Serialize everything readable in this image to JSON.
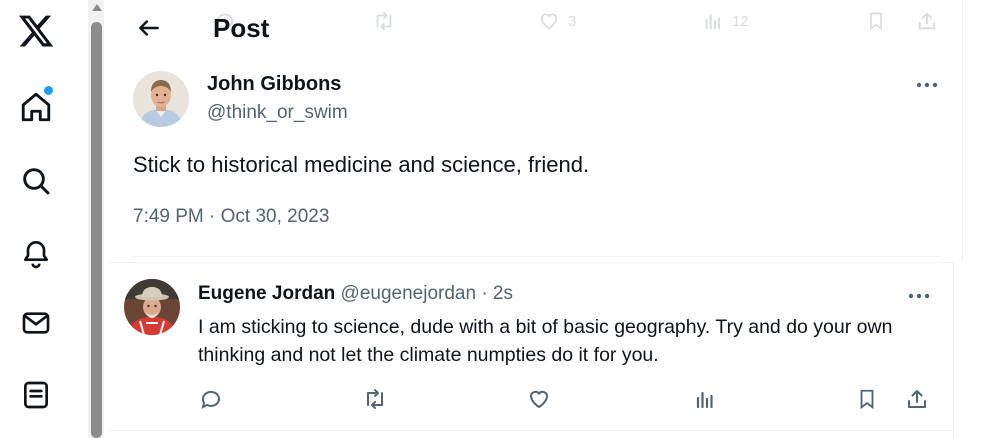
{
  "nav": {
    "items": [
      {
        "icon": "x-logo-icon"
      },
      {
        "icon": "home-icon",
        "has_notification_dot": true
      },
      {
        "icon": "search-icon"
      },
      {
        "icon": "bell-icon"
      },
      {
        "icon": "mail-icon"
      },
      {
        "icon": "list-icon"
      }
    ]
  },
  "header": {
    "title": "Post",
    "back_icon": "arrow-left-icon"
  },
  "ghost_actions": {
    "likes": "3",
    "views": "12"
  },
  "post": {
    "author_name": "John Gibbons",
    "author_handle": "@think_or_swim",
    "text": "Stick to historical medicine and science, friend.",
    "timestamp": "7:49 PM · Oct 30, 2023"
  },
  "reply": {
    "author_name": "Eugene Jordan",
    "author_handle": "@eugenejordan",
    "time_ago": "· 2s",
    "text": "I am sticking to science, dude with a bit of basic geography. Try and do your own thinking and not let the climate numpties do it for you.",
    "actions": [
      "reply-icon",
      "retweet-icon",
      "like-icon",
      "views-icon",
      "bookmark-icon",
      "share-icon"
    ]
  },
  "colors": {
    "accent": "#1d9bf0",
    "text": "#0f1419",
    "secondary": "#536471",
    "border": "#eff3f4"
  }
}
